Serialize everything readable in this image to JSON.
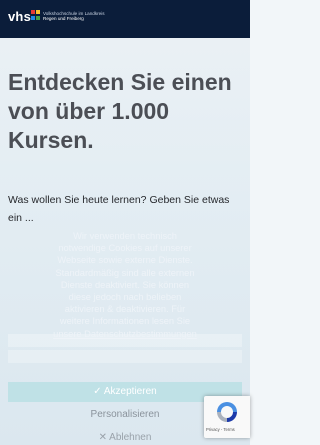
{
  "header": {
    "logo": "vhs",
    "org_line1": "Volkshochschule im Landkreis",
    "org_line2": "Regen und Freiberg"
  },
  "hero": {
    "title": "Entdecken Sie einen von über 1.000 Kursen.",
    "search_placeholder": "Was wollen Sie heute lernen? Geben Sie etwas ein ..."
  },
  "cookie": {
    "text": "Wir verwenden technisch notwendige Cookies auf unserer Webseite sowie externe Dienste. Standardmäßig sind alle externen Dienste deaktiviert. Sie können diese jedoch nach belieben aktivieren & deaktivieren. Für weitere Informationen lesen Sie",
    "link": "unsere Datenschutzbestimmungen",
    "accept_label": "✓ Akzeptieren",
    "personalize_label": "Personalisieren",
    "decline_label": "✕ Ablehnen"
  },
  "recaptcha": {
    "links": "Privacy - Terms"
  },
  "colors": {
    "header_bg": "#0b1d3a",
    "title_text": "#4b4e55",
    "accept_bg": "#bfe1e6"
  }
}
